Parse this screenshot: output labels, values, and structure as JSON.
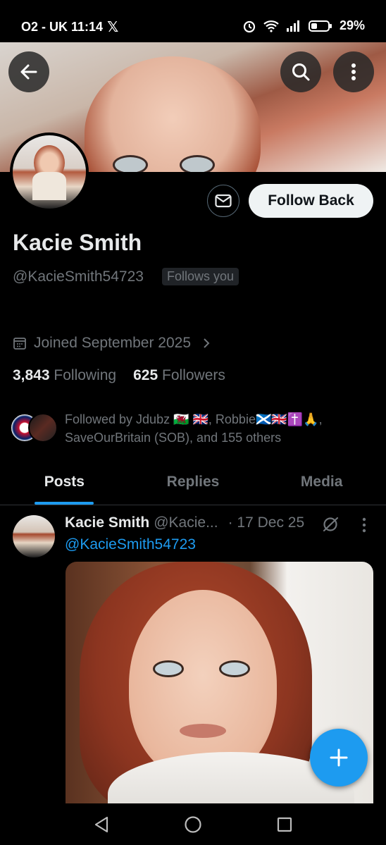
{
  "status": {
    "carrier_time": "O2 - UK 11:14",
    "x_glyph": "𝕏",
    "battery": "29%"
  },
  "header": {
    "back_icon": "arrow-left-icon",
    "search_icon": "search-icon",
    "more_icon": "more-vertical-icon"
  },
  "profile": {
    "name": "Kacie Smith",
    "handle": "@KacieSmith54723",
    "follows_you": "Follows you",
    "follow_label": "Follow Back",
    "joined": "Joined September 2025",
    "following_count": "3,843",
    "following_label": "Following",
    "followers_count": "625",
    "followers_label": "Followers",
    "followed_by": "Followed by Jdubz 🏴󠁧󠁢󠁷󠁬󠁳󠁿 🇬🇧, Robbie🏴󠁧󠁢󠁳󠁣󠁴󠁿🇬🇧✝️🙏, SaveOurBritain (SOB), and 155 others"
  },
  "tabs": [
    "Posts",
    "Replies",
    "Media"
  ],
  "post": {
    "name": "Kacie Smith",
    "handle": "@Kacie...",
    "date": "· 17 Dec 25",
    "mention": "@KacieSmith54723"
  },
  "colors": {
    "accent": "#1d9bf0",
    "background": "#000000",
    "text": "#e7e9ea",
    "muted": "#71767b"
  }
}
